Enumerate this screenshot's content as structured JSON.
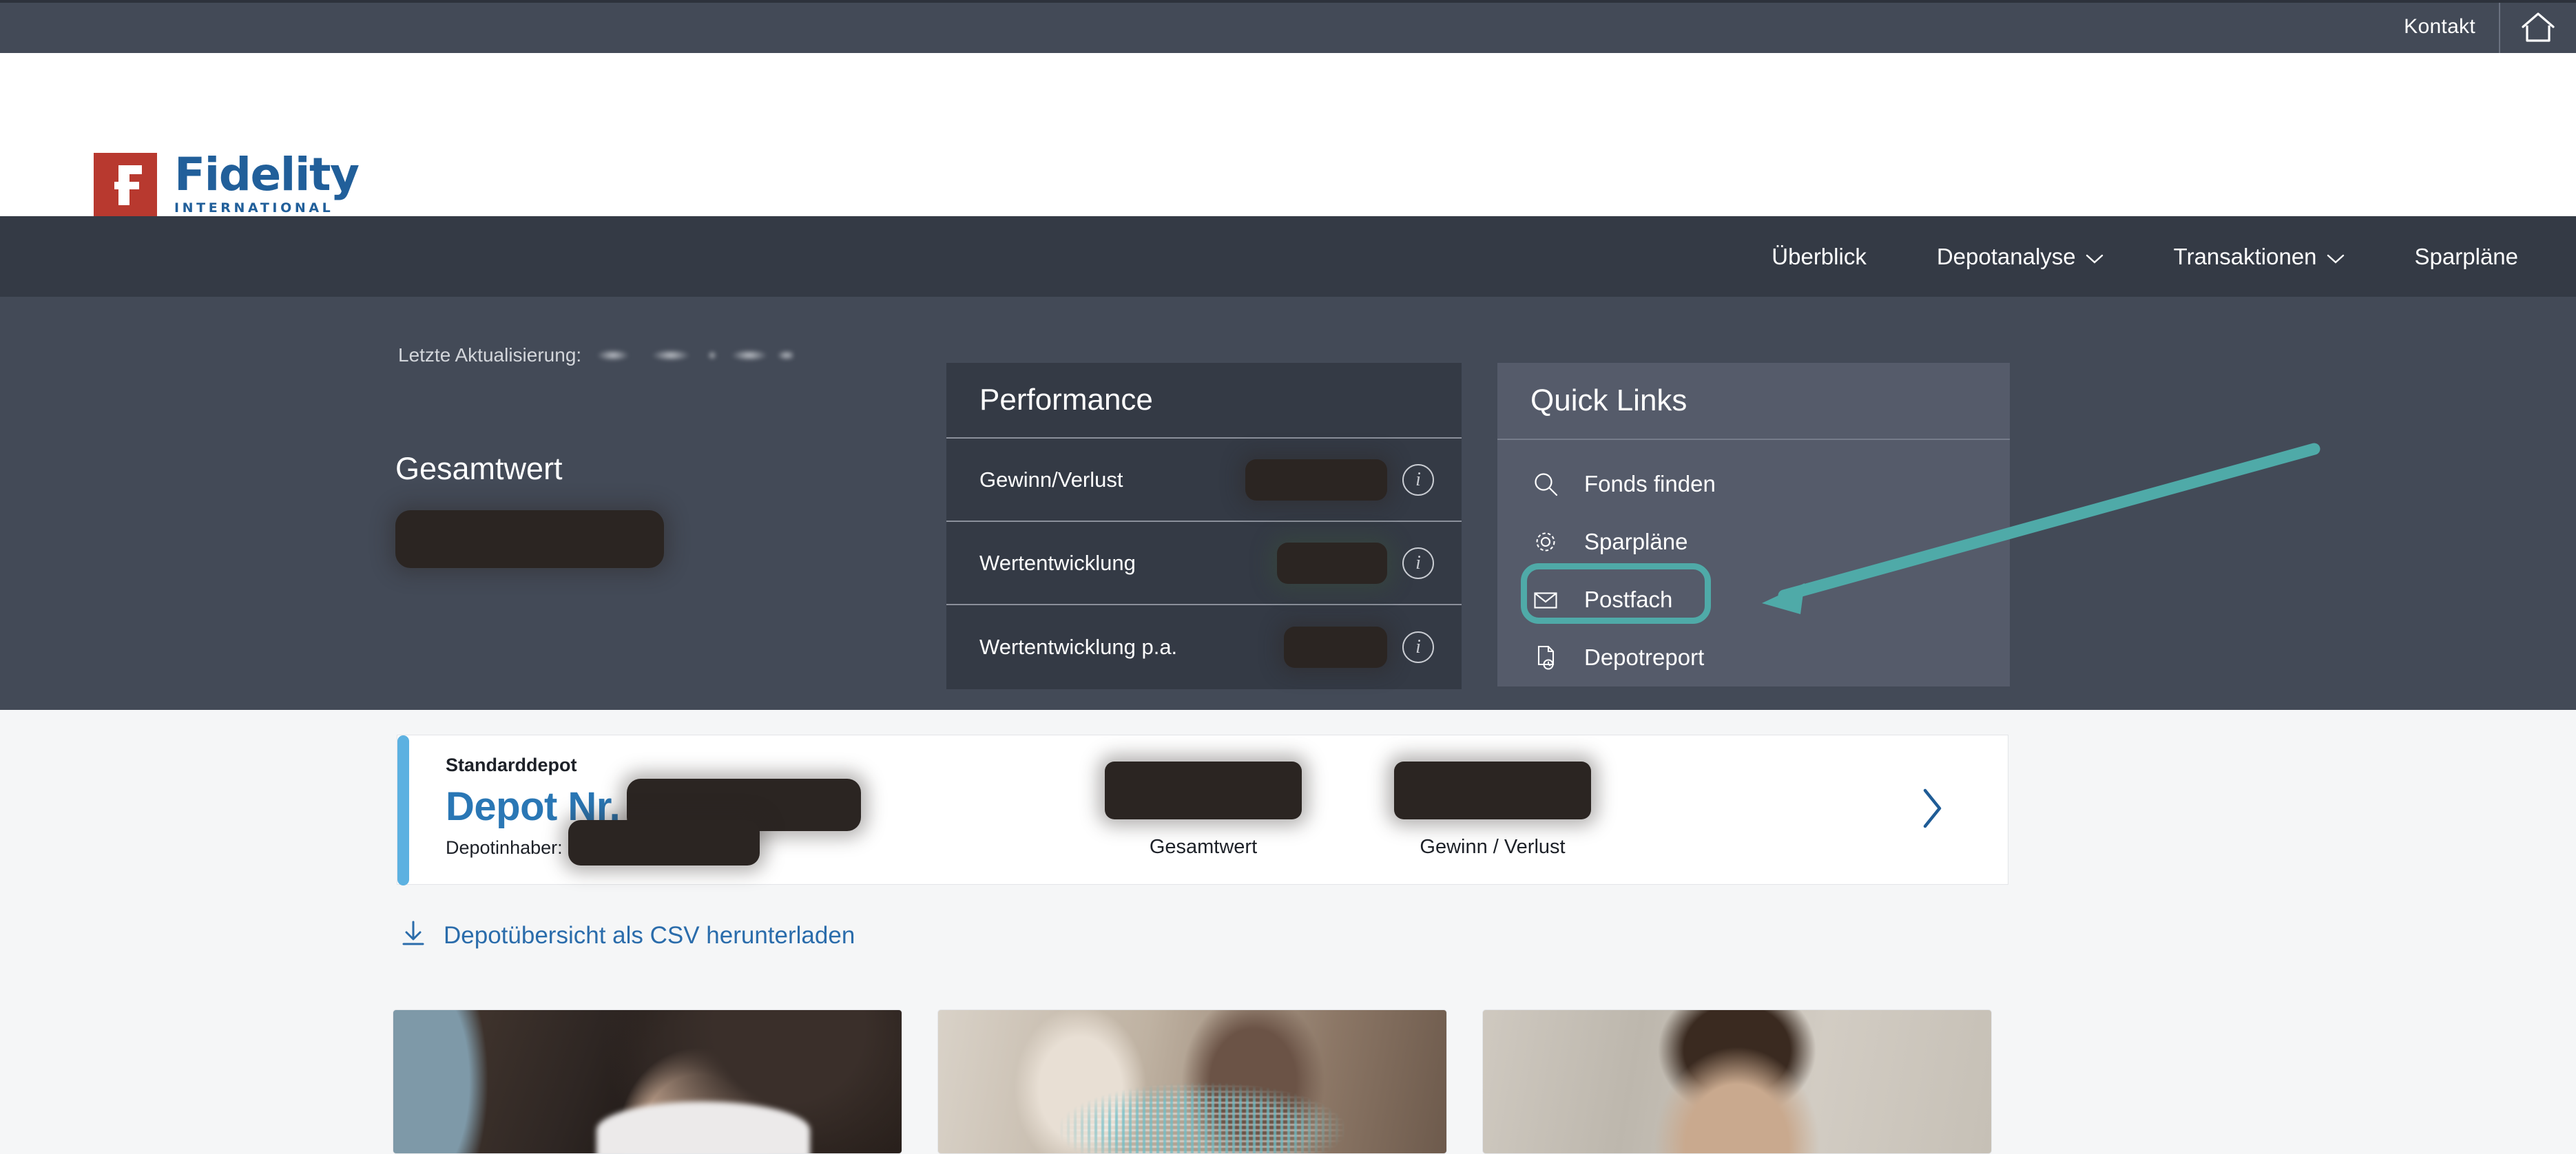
{
  "utility_bar": {
    "contact_label": "Kontakt",
    "home_icon": "home-icon"
  },
  "brand": {
    "logo_mark": "fidelity-f-mark",
    "name": "Fidelity",
    "tagline": "INTERNATIONAL"
  },
  "main_nav": {
    "items": [
      {
        "label": "Überblick",
        "has_caret": false
      },
      {
        "label": "Depotanalyse",
        "has_caret": true
      },
      {
        "label": "Transaktionen",
        "has_caret": true
      },
      {
        "label": "Sparpläne",
        "has_caret": false
      }
    ],
    "caret_glyph": "⌄"
  },
  "hero": {
    "last_update_label": "Letzte Aktualisierung:",
    "last_update_value": "",
    "total_label": "Gesamtwert",
    "total_value": ""
  },
  "performance": {
    "title": "Performance",
    "rows": [
      {
        "label": "Gewinn/Verlust",
        "value": "",
        "info_icon": "info-icon"
      },
      {
        "label": "Wertentwicklung",
        "value": "",
        "info_icon": "info-icon"
      },
      {
        "label": "Wertentwicklung p.a.",
        "value": "",
        "info_icon": "info-icon"
      }
    ]
  },
  "quick_links": {
    "title": "Quick Links",
    "items": [
      {
        "label": "Fonds finden",
        "icon": "search-icon"
      },
      {
        "label": "Sparpläne",
        "icon": "gear-icon"
      },
      {
        "label": "Postfach",
        "icon": "envelope-icon",
        "highlighted": true
      },
      {
        "label": "Depotreport",
        "icon": "document-clock-icon"
      }
    ]
  },
  "annotation": {
    "type": "arrow-pointing-left",
    "target": "Postfach",
    "color": "#4faaa8"
  },
  "depot_card": {
    "type_label": "Standarddepot",
    "number_label": "Depot Nr.",
    "number_value": "",
    "owner_label": "Depotinhaber:",
    "owner_value": "",
    "stats": [
      {
        "label": "Gesamtwert",
        "value": ""
      },
      {
        "label": "Gewinn / Verlust",
        "value": ""
      }
    ],
    "chevron_icon": "chevron-right-icon",
    "accent_color": "#5cb1e1"
  },
  "csv_download": {
    "label": "Depotübersicht als CSV herunterladen",
    "icon": "download-icon",
    "color": "#2a6cab"
  },
  "promo_cards": [
    {
      "image_alt": "woman-at-desk-photo"
    },
    {
      "image_alt": "two-people-with-data-overlay-photo"
    },
    {
      "image_alt": "man-portrait-photo"
    }
  ],
  "colors": {
    "utility_bar_bg": "#434a57",
    "nav_bg": "#343a45",
    "hero_bg": "#434a57",
    "performance_card_bg": "#343a45",
    "quick_links_card_bg": "#555b6a",
    "brand_blue": "#215f9a",
    "brand_red": "#b8392f",
    "accent_teal": "#4faaa8",
    "light_bg": "#f5f6f7"
  }
}
